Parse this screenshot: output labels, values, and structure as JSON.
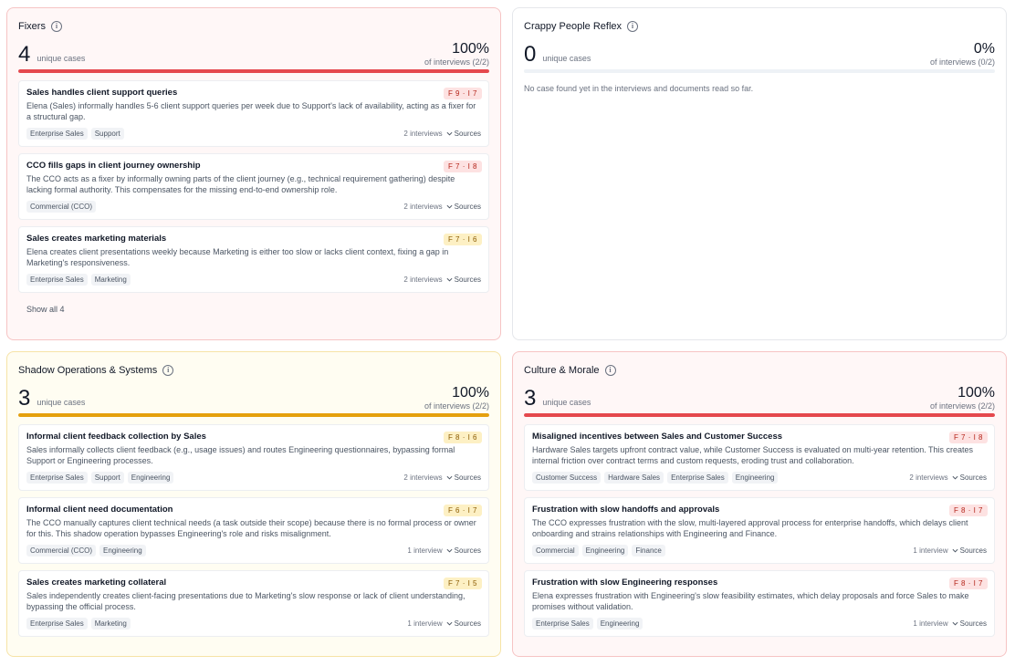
{
  "panels": {
    "fixers": {
      "title": "Fixers",
      "count": "4",
      "count_label": "unique cases",
      "pct": "100%",
      "pct_sub": "of interviews (2/2)",
      "progress": 1.0,
      "bar_color": "#e5484d",
      "show_all": "Show all 4",
      "cards": [
        {
          "title": "Sales handles client support queries",
          "badge": "F 9 · I 7",
          "desc": "Elena (Sales) informally handles 5-6 client support queries per week due to Support's lack of availability, acting as a fixer for a structural gap.",
          "tags": [
            "Enterprise Sales",
            "Support"
          ],
          "interviews": "2 interviews",
          "sources": "Sources"
        },
        {
          "title": "CCO fills gaps in client journey ownership",
          "badge": "F 7 · I 8",
          "desc": "The CCO acts as a fixer by informally owning parts of the client journey (e.g., technical requirement gathering) despite lacking formal authority. This compensates for the missing end-to-end ownership role.",
          "tags": [
            "Commercial (CCO)"
          ],
          "interviews": "2 interviews",
          "sources": "Sources"
        },
        {
          "title": "Sales creates marketing materials",
          "badge": "F 7 · I 6",
          "desc": "Elena creates client presentations weekly because Marketing is either too slow or lacks client context, fixing a gap in Marketing's responsiveness.",
          "tags": [
            "Enterprise Sales",
            "Marketing"
          ],
          "interviews": "2 interviews",
          "sources": "Sources"
        }
      ]
    },
    "crappy": {
      "title": "Crappy People Reflex",
      "count": "0",
      "count_label": "unique cases",
      "pct": "0%",
      "pct_sub": "of interviews (0/2)",
      "progress": 0.0,
      "empty_text": "No case found yet in the interviews and documents read so far."
    },
    "shadow": {
      "title": "Shadow Operations & Systems",
      "count": "3",
      "count_label": "unique cases",
      "pct": "100%",
      "pct_sub": "of interviews (2/2)",
      "progress": 1.0,
      "bar_color": "#e5a00d",
      "cards": [
        {
          "title": "Informal client feedback collection by Sales",
          "badge": "F 8 · I 6",
          "desc": "Sales informally collects client feedback (e.g., usage issues) and routes Engineering questionnaires, bypassing formal Support or Engineering processes.",
          "tags": [
            "Enterprise Sales",
            "Support",
            "Engineering"
          ],
          "interviews": "2 interviews",
          "sources": "Sources"
        },
        {
          "title": "Informal client need documentation",
          "badge": "F 6 · I 7",
          "desc": "The CCO manually captures client technical needs (a task outside their scope) because there is no formal process or owner for this. This shadow operation bypasses Engineering's role and risks misalignment.",
          "tags": [
            "Commercial (CCO)",
            "Engineering"
          ],
          "interviews": "1 interview",
          "sources": "Sources"
        },
        {
          "title": "Sales creates marketing collateral",
          "badge": "F 7 · I 5",
          "desc": "Sales independently creates client-facing presentations due to Marketing's slow response or lack of client understanding, bypassing the official process.",
          "tags": [
            "Enterprise Sales",
            "Marketing"
          ],
          "interviews": "1 interview",
          "sources": "Sources"
        }
      ]
    },
    "culture": {
      "title": "Culture & Morale",
      "count": "3",
      "count_label": "unique cases",
      "pct": "100%",
      "pct_sub": "of interviews (2/2)",
      "progress": 1.0,
      "bar_color": "#e5484d",
      "cards": [
        {
          "title": "Misaligned incentives between Sales and Customer Success",
          "badge": "F 7 · I 8",
          "desc": "Hardware Sales targets upfront contract value, while Customer Success is evaluated on multi-year retention. This creates internal friction over contract terms and custom requests, eroding trust and collaboration.",
          "tags": [
            "Customer Success",
            "Hardware Sales",
            "Enterprise Sales",
            "Engineering"
          ],
          "interviews": "2 interviews",
          "sources": "Sources"
        },
        {
          "title": "Frustration with slow handoffs and approvals",
          "badge": "F 8 · I 7",
          "desc": "The CCO expresses frustration with the slow, multi-layered approval process for enterprise handoffs, which delays client onboarding and strains relationships with Engineering and Finance.",
          "tags": [
            "Commercial",
            "Engineering",
            "Finance"
          ],
          "interviews": "1 interview",
          "sources": "Sources"
        },
        {
          "title": "Frustration with slow Engineering responses",
          "badge": "F 8 · I 7",
          "desc": "Elena expresses frustration with Engineering's slow feasibility estimates, which delay proposals and force Sales to make promises without validation.",
          "tags": [
            "Enterprise Sales",
            "Engineering"
          ],
          "interviews": "1 interview",
          "sources": "Sources"
        }
      ]
    }
  }
}
